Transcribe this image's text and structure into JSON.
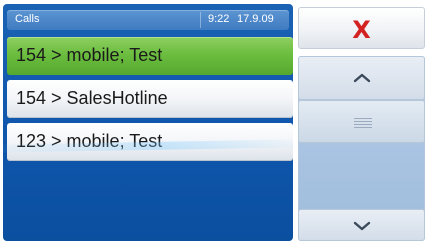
{
  "status_bar": {
    "title": "Calls",
    "time": "9:22",
    "date": "17.9.09"
  },
  "calls": [
    {
      "label": "154 > mobile; Test",
      "selected": true
    },
    {
      "label": "154 > SalesHotline",
      "selected": false
    },
    {
      "label": "123 > mobile; Test",
      "selected": false
    }
  ],
  "controls": {
    "close_symbol": "X",
    "close_icon": "close-x-icon",
    "scroll_up_icon": "chevron-up-icon",
    "scroll_thumb_icon": "grip-lines-icon",
    "scroll_down_icon": "chevron-down-icon"
  },
  "colors": {
    "panel_blue": "#1259ad",
    "selected_green": "#6cbd40",
    "close_red": "#d32222"
  }
}
